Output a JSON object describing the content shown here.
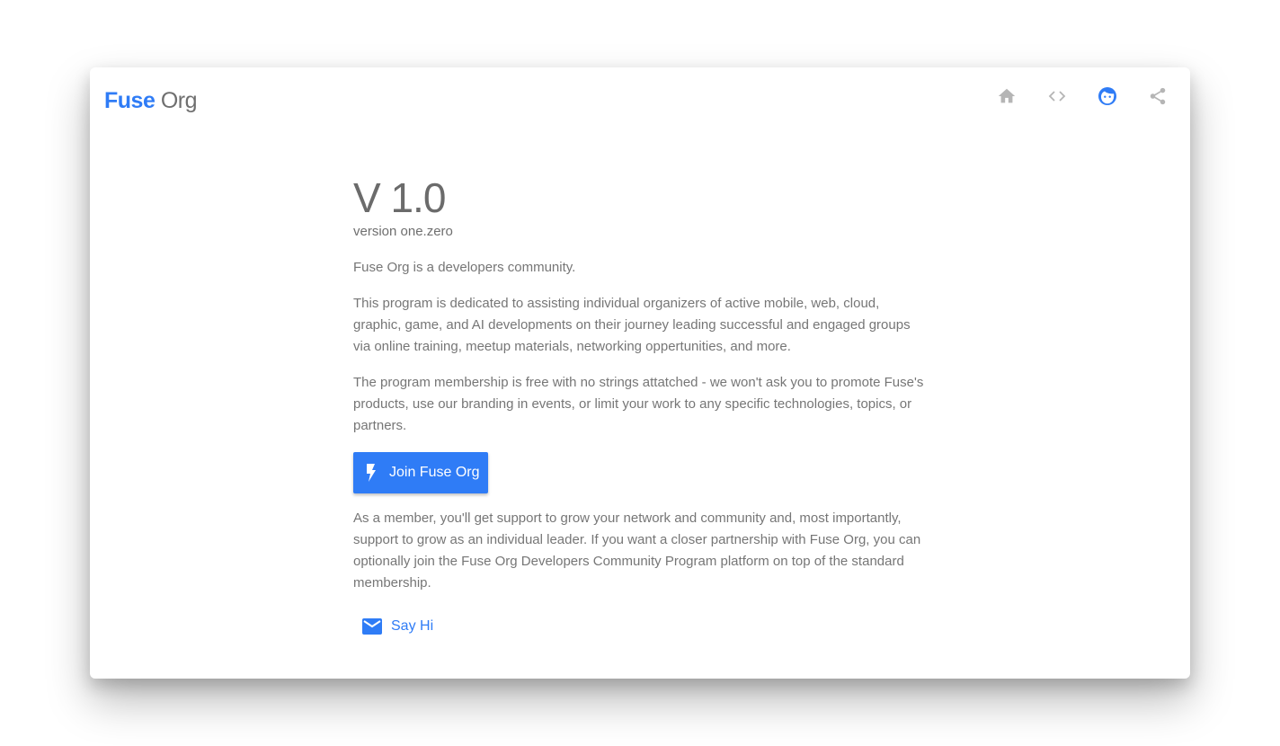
{
  "header": {
    "logo_brand": "Fuse",
    "logo_org": "Org",
    "nav": [
      {
        "icon": "home-icon"
      },
      {
        "icon": "code-icon"
      },
      {
        "icon": "face-icon",
        "active": true
      },
      {
        "icon": "share-icon"
      }
    ]
  },
  "main": {
    "version_title": "V 1.0",
    "version_subtitle": "version one.zero",
    "intro": "Fuse Org is a developers community.",
    "paragraph_1": "This program is dedicated to assisting individual organizers of active mobile, web, cloud, graphic, game, and AI developments on their journey leading successful and engaged groups via online training, meetup materials, networking oppertunities, and more.",
    "paragraph_2": "The program membership is free with no strings attatched - we won't ask you to promote Fuse's products, use our branding in events, or limit your work to any specific technologies, topics, or partners.",
    "join_button_label": "Join Fuse Org",
    "paragraph_3": "As a member, you'll get support to grow your network and community and, most importantly, support to grow as an individual leader. If you want a closer partnership with Fuse Org, you can optionally join the Fuse Org Developers Community Program platform on top of the standard membership.",
    "say_hi_label": "Say Hi"
  },
  "colors": {
    "accent": "#2f7cf6",
    "text": "#767676",
    "icon_muted": "#b5b5b5"
  }
}
